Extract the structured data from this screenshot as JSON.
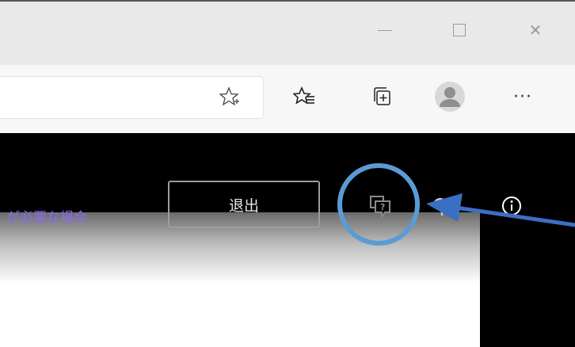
{
  "window_controls": {
    "minimize_icon": "minimize-icon",
    "maximize_icon": "maximize-icon",
    "close_glyph": "✕"
  },
  "toolbar": {
    "icons": [
      "add-favorite-star-icon",
      "favorites-list-icon",
      "collections-icon",
      "profile-avatar-icon"
    ],
    "more_label": "···"
  },
  "page": {
    "help_text": "が必要な場合",
    "exit_label": "退出",
    "icons": [
      "feedback-icon",
      "settings-icon",
      "info-icon"
    ]
  },
  "annotation": {
    "circle_color": "#5b9bd5",
    "arrow_color": "#3b6fc4"
  },
  "colors": {
    "titlebar": "#e9e9e9",
    "toolbar": "#f7f7f7",
    "page_background": "#000000",
    "link": "#8a6cf0"
  }
}
